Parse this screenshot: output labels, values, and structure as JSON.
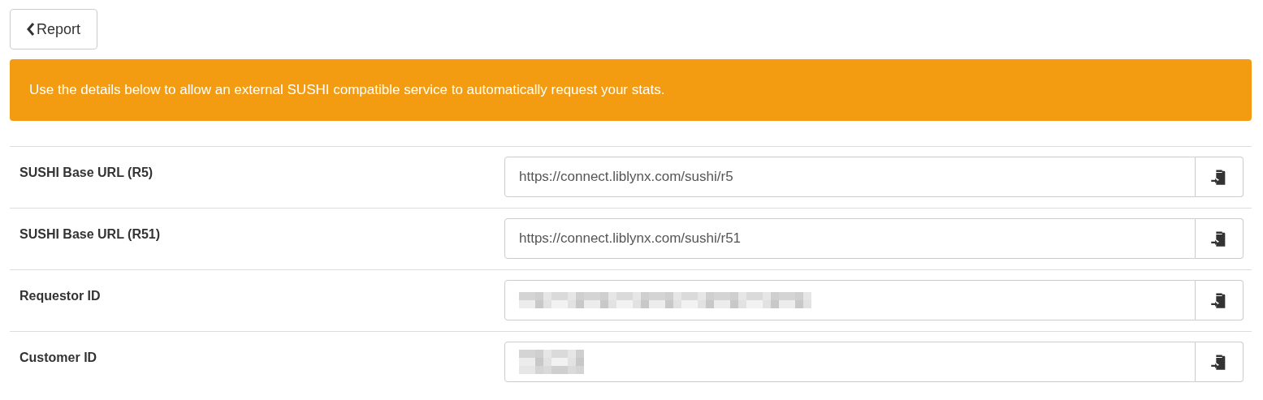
{
  "back_button": {
    "label": "Report"
  },
  "alert": {
    "text": "Use the details below to allow an external SUSHI compatible service to automatically request your stats."
  },
  "fields": [
    {
      "kind": "text",
      "label": "SUSHI Base URL (R5)",
      "value": "https://connect.liblynx.com/sushi/r5"
    },
    {
      "kind": "text",
      "label": "SUSHI Base URL (R51)",
      "value": "https://connect.liblynx.com/sushi/r51"
    },
    {
      "kind": "long_redacted",
      "label": "Requestor ID"
    },
    {
      "kind": "short_redacted",
      "label": "Customer ID"
    }
  ]
}
